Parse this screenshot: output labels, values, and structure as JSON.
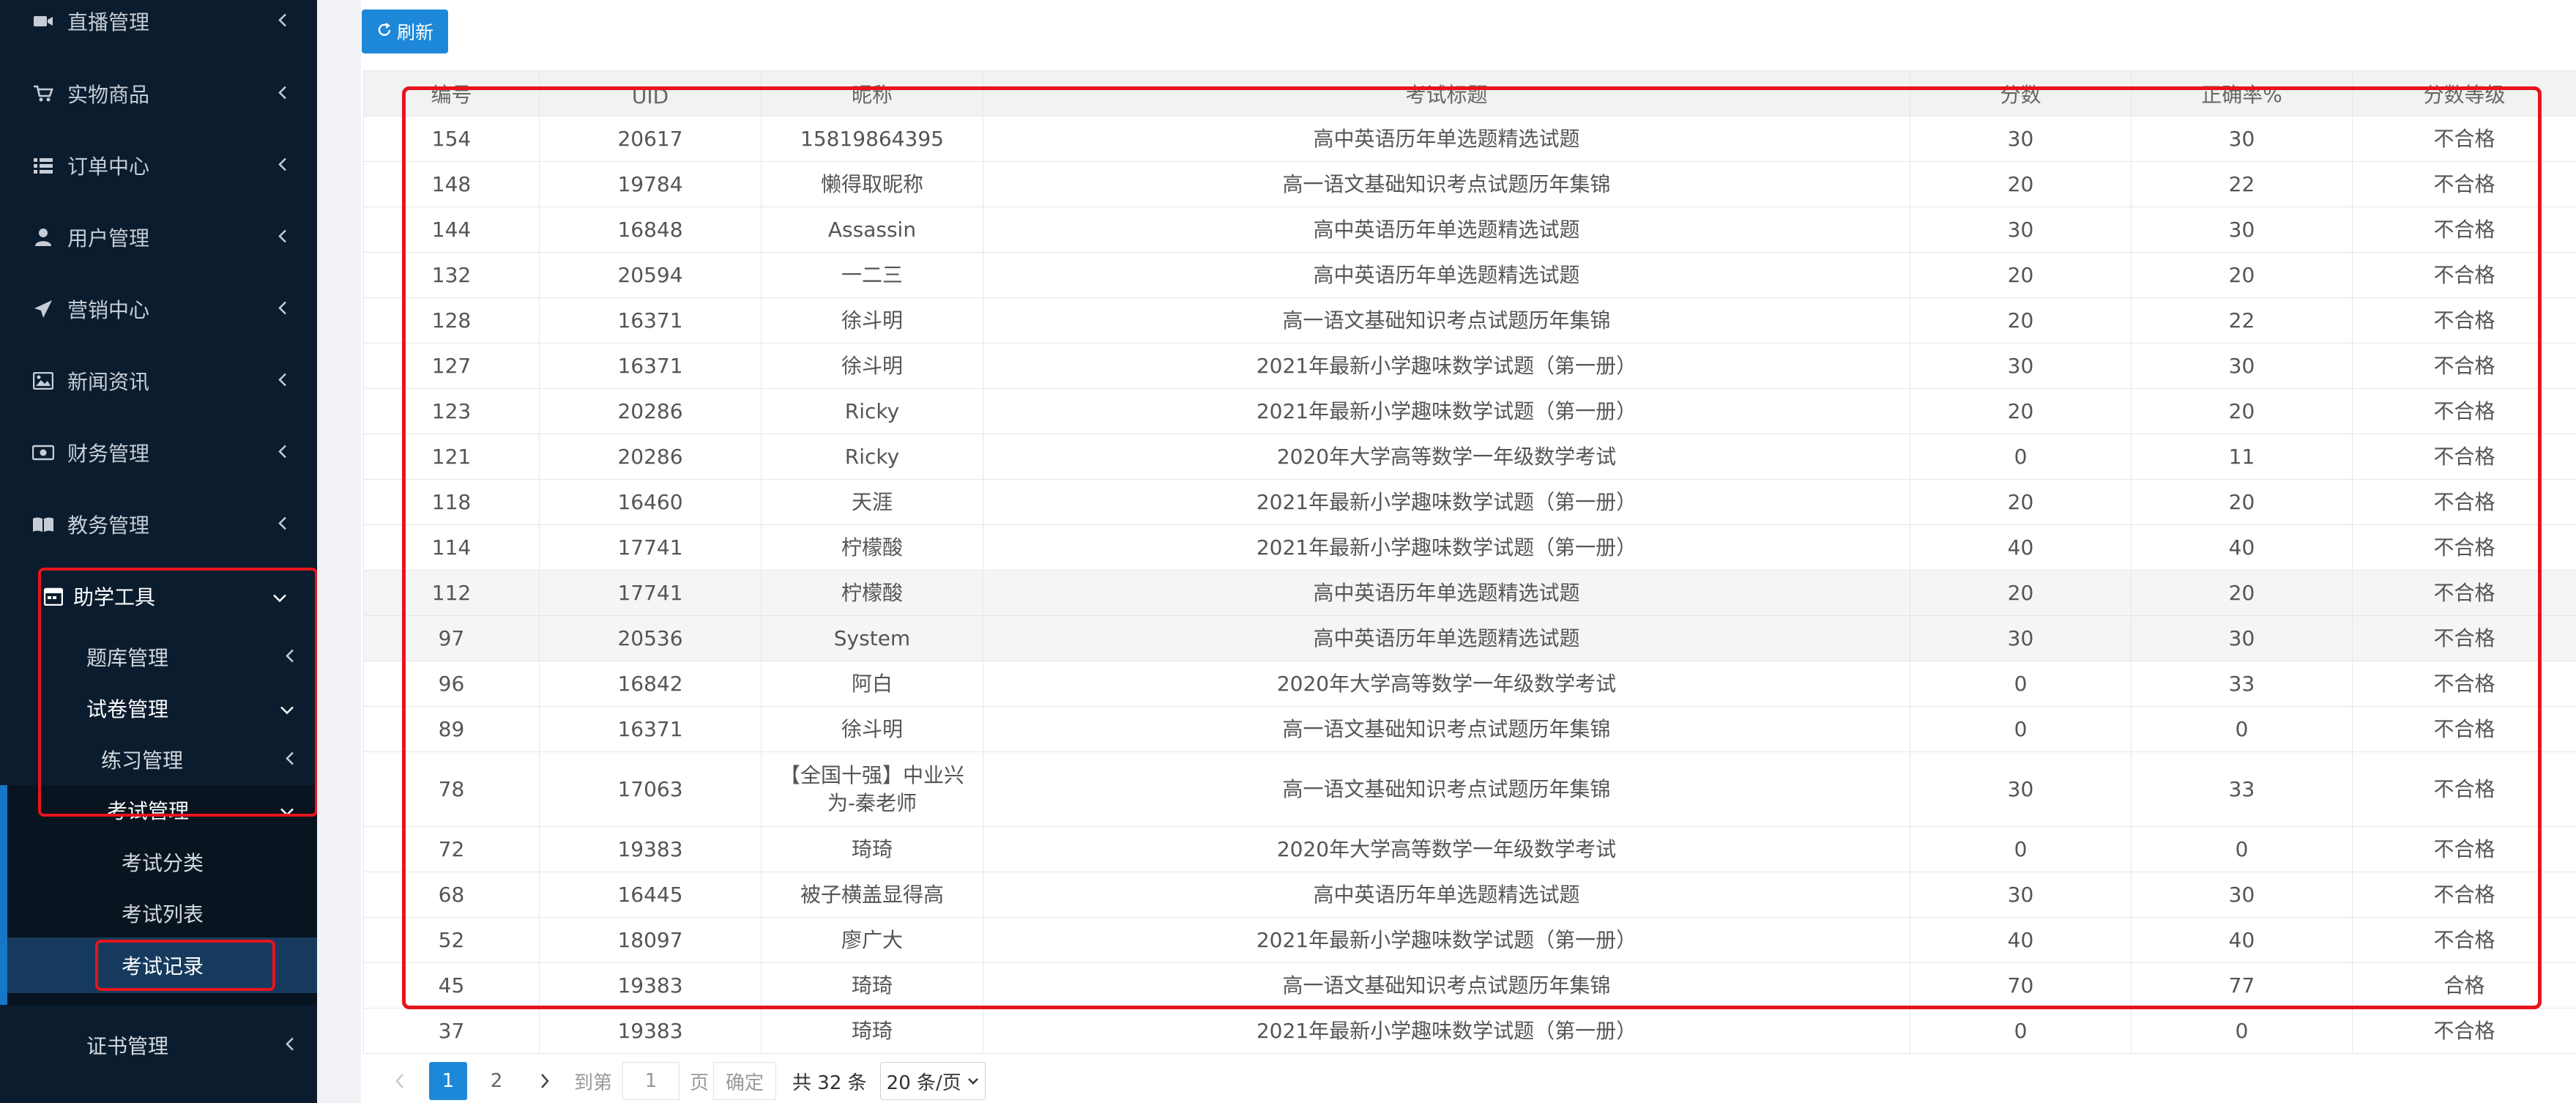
{
  "colors": {
    "sidebar_bg": "#0b1c2e",
    "accent": "#1e88d8",
    "highlight": "#e8141c"
  },
  "sidebar": {
    "items": [
      {
        "label": "直播管理",
        "icon": "video-icon"
      },
      {
        "label": "实物商品",
        "icon": "cart-icon"
      },
      {
        "label": "订单中心",
        "icon": "list-icon"
      },
      {
        "label": "用户管理",
        "icon": "user-icon"
      },
      {
        "label": "营销中心",
        "icon": "send-icon"
      },
      {
        "label": "新闻资讯",
        "icon": "image-icon"
      },
      {
        "label": "财务管理",
        "icon": "money-icon"
      },
      {
        "label": "教务管理",
        "icon": "book-icon"
      },
      {
        "label": "助学工具",
        "icon": "calendar-icon"
      }
    ],
    "sub": {
      "tiku": "题库管理",
      "shijuan": "试卷管理",
      "lianxi": "练习管理",
      "kaoshi": "考试管理",
      "kaoshi_fenlei": "考试分类",
      "kaoshi_liebiao": "考试列表",
      "kaoshi_jilu": "考试记录",
      "zhengshu": "证书管理"
    }
  },
  "toolbar": {
    "refresh_label": "刷新"
  },
  "table": {
    "headers": [
      "编号",
      "UID",
      "昵称",
      "考试标题",
      "分数",
      "正确率%",
      "分数等级"
    ],
    "rows": [
      [
        "154",
        "20617",
        "15819864395",
        "高中英语历年单选题精选试题",
        "30",
        "30",
        "不合格"
      ],
      [
        "148",
        "19784",
        "懒得取昵称",
        "高一语文基础知识考点试题历年集锦",
        "20",
        "22",
        "不合格"
      ],
      [
        "144",
        "16848",
        "Assassin",
        "高中英语历年单选题精选试题",
        "30",
        "30",
        "不合格"
      ],
      [
        "132",
        "20594",
        "一二三",
        "高中英语历年单选题精选试题",
        "20",
        "20",
        "不合格"
      ],
      [
        "128",
        "16371",
        "徐斗明",
        "高一语文基础知识考点试题历年集锦",
        "20",
        "22",
        "不合格"
      ],
      [
        "127",
        "16371",
        "徐斗明",
        "2021年最新小学趣味数学试题（第一册）",
        "30",
        "30",
        "不合格"
      ],
      [
        "123",
        "20286",
        "Ricky",
        "2021年最新小学趣味数学试题（第一册）",
        "20",
        "20",
        "不合格"
      ],
      [
        "121",
        "20286",
        "Ricky",
        "2020年大学高等数学一年级数学考试",
        "0",
        "11",
        "不合格"
      ],
      [
        "118",
        "16460",
        "天涯",
        "2021年最新小学趣味数学试题（第一册）",
        "20",
        "20",
        "不合格"
      ],
      [
        "114",
        "17741",
        "柠檬酸",
        "2021年最新小学趣味数学试题（第一册）",
        "40",
        "40",
        "不合格"
      ],
      [
        "112",
        "17741",
        "柠檬酸",
        "高中英语历年单选题精选试题",
        "20",
        "20",
        "不合格"
      ],
      [
        "97",
        "20536",
        "System",
        "高中英语历年单选题精选试题",
        "30",
        "30",
        "不合格"
      ],
      [
        "96",
        "16842",
        "阿白",
        "2020年大学高等数学一年级数学考试",
        "0",
        "33",
        "不合格"
      ],
      [
        "89",
        "16371",
        "徐斗明",
        "高一语文基础知识考点试题历年集锦",
        "0",
        "0",
        "不合格"
      ],
      [
        "78",
        "17063",
        "【全国十强】中业兴为-秦老师",
        "高一语文基础知识考点试题历年集锦",
        "30",
        "33",
        "不合格"
      ],
      [
        "72",
        "19383",
        "琦琦",
        "2020年大学高等数学一年级数学考试",
        "0",
        "0",
        "不合格"
      ],
      [
        "68",
        "16445",
        "被子横盖显得高",
        "高中英语历年单选题精选试题",
        "30",
        "30",
        "不合格"
      ],
      [
        "52",
        "18097",
        "廖广大",
        "2021年最新小学趣味数学试题（第一册）",
        "40",
        "40",
        "不合格"
      ],
      [
        "45",
        "19383",
        "琦琦",
        "高一语文基础知识考点试题历年集锦",
        "70",
        "77",
        "合格"
      ],
      [
        "37",
        "19383",
        "琦琦",
        "2021年最新小学趣味数学试题（第一册）",
        "0",
        "0",
        "不合格"
      ]
    ]
  },
  "pager": {
    "pages": [
      "1",
      "2"
    ],
    "goto_prefix": "到第",
    "goto_value": "1",
    "goto_suffix": "页",
    "confirm": "确定",
    "total": "共 32 条",
    "page_size": "20 条/页"
  }
}
